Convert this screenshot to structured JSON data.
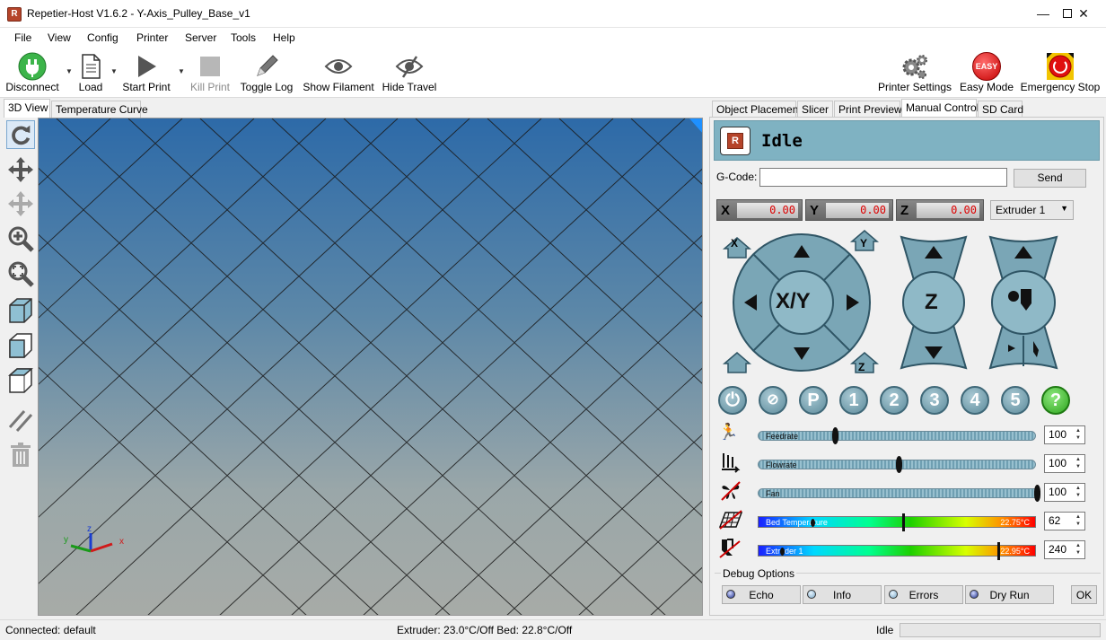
{
  "window": {
    "title": "Repetier-Host V1.6.2 - Y-Axis_Pulley_Base_v1",
    "app_icon": "R"
  },
  "menu": [
    "File",
    "View",
    "Config",
    "Printer",
    "Server",
    "Tools",
    "Help"
  ],
  "toolbar": {
    "disconnect": "Disconnect",
    "load": "Load",
    "start_print": "Start Print",
    "kill_print": "Kill Print",
    "toggle_log": "Toggle Log",
    "show_filament": "Show Filament",
    "hide_travel": "Hide Travel",
    "printer_settings": "Printer Settings",
    "easy_mode": "Easy Mode",
    "easy_badge": "EASY",
    "emergency_stop": "Emergency Stop"
  },
  "left_tabs": [
    "3D View",
    "Temperature Curve"
  ],
  "right_tabs": [
    "Object Placement",
    "Slicer",
    "Print Preview",
    "Manual Control",
    "SD Card"
  ],
  "manual": {
    "status": "Idle",
    "gcode_label": "G-Code:",
    "gcode_value": "",
    "send": "Send",
    "x_label": "X",
    "x_value": "0.00",
    "y_label": "Y",
    "y_value": "0.00",
    "z_label": "Z",
    "z_value": "0.00",
    "extruder_select": "Extruder 1",
    "xy_label": "X/Y",
    "z_jog_label": "Z",
    "home_x": "X",
    "home_y": "Y",
    "home_z": "Z",
    "power_btn": "⏻",
    "p_btn": "P",
    "numbers": [
      "1",
      "2",
      "3",
      "4",
      "5"
    ],
    "help_btn": "?"
  },
  "sliders": {
    "feedrate": {
      "label": "Feedrate",
      "value": "100",
      "level": 0.27
    },
    "flowrate": {
      "label": "Flowrate",
      "value": "100",
      "level": 0.5
    },
    "fan": {
      "label": "Fan",
      "value": "100",
      "level": 1.0
    }
  },
  "temps": {
    "bed": {
      "label": "Bed Temperature",
      "reading": "22.75°C",
      "target": "62"
    },
    "extruder": {
      "label": "Extruder 1",
      "reading": "22.95°C",
      "target": "240"
    }
  },
  "debug": {
    "title": "Debug Options",
    "echo": "Echo",
    "info": "Info",
    "errors": "Errors",
    "dry_run": "Dry Run",
    "ok": "OK"
  },
  "statusbar": {
    "connection": "Connected: default",
    "temps": "Extruder: 23.0°C/Off Bed: 22.8°C/Off",
    "state": "Idle"
  },
  "colors": {
    "status_header": "#7fb2c2",
    "jog_button": "#7aa6b6",
    "accent_blue": "#1e90ff"
  }
}
